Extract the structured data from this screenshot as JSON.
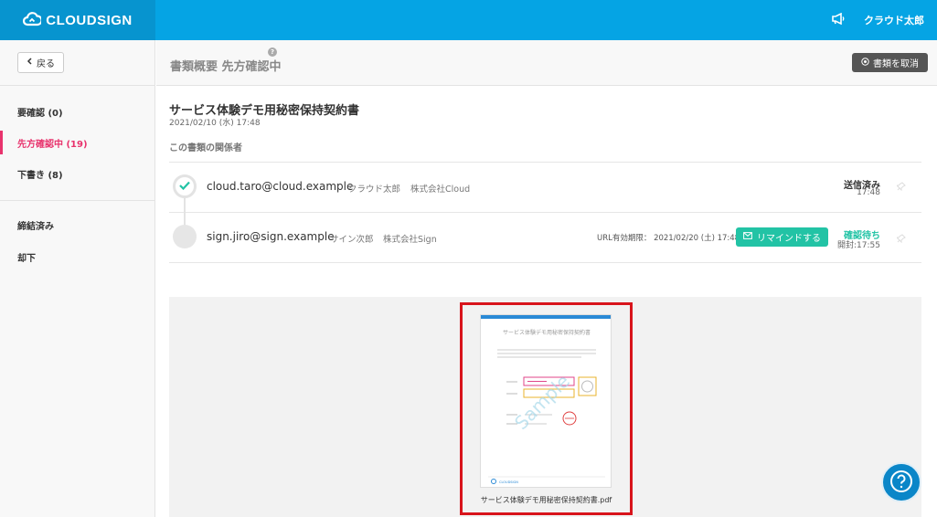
{
  "header": {
    "logo_text": "CLOUDSIGN",
    "user_name": "クラウド太郎",
    "icons": [
      "cloud-logo-icon",
      "megaphone-icon"
    ]
  },
  "sidebar": {
    "back_label": "戻る",
    "items": [
      {
        "label": "要確認 (0)"
      },
      {
        "label": "先方確認中 (19)",
        "active": true
      },
      {
        "label": "下書き (8)"
      },
      {
        "label": "締結済み"
      },
      {
        "label": "却下"
      }
    ]
  },
  "page_header": {
    "title": "書類概要 先方確認中",
    "help": "?",
    "cancel_label": "書類を取消"
  },
  "document": {
    "title": "サービス体験デモ用秘密保持契約書",
    "date": "2021/02/10 (水) 17:48",
    "section_title": "この書類の関係者"
  },
  "participants": [
    {
      "email": "cloud.taro@cloud.example",
      "name": "クラウド太郎",
      "company": "株式会社Cloud",
      "status": "送信済み",
      "time": "17:48"
    },
    {
      "email": "sign.jiro@sign.example",
      "name": "サイン次郎",
      "company": "株式会社Sign",
      "url_expiry": "URL有効期限： 2021/02/20 (土) 17:48",
      "remind_label": "リマインドする",
      "status": "確認待ち",
      "time": "開封:17:55"
    }
  ],
  "preview": {
    "page_title": "サービス体験デモ用秘密保持契約書",
    "watermark": "Sample",
    "footer_logo": "CLOUDSIGN",
    "file_name": "サービス体験デモ用秘密保持契約書.pdf"
  },
  "colors": {
    "brand": "#05a4e4",
    "accent_active": "#e8336d",
    "confirm_green": "#22c3a5",
    "highlight_red": "#d8141c"
  }
}
